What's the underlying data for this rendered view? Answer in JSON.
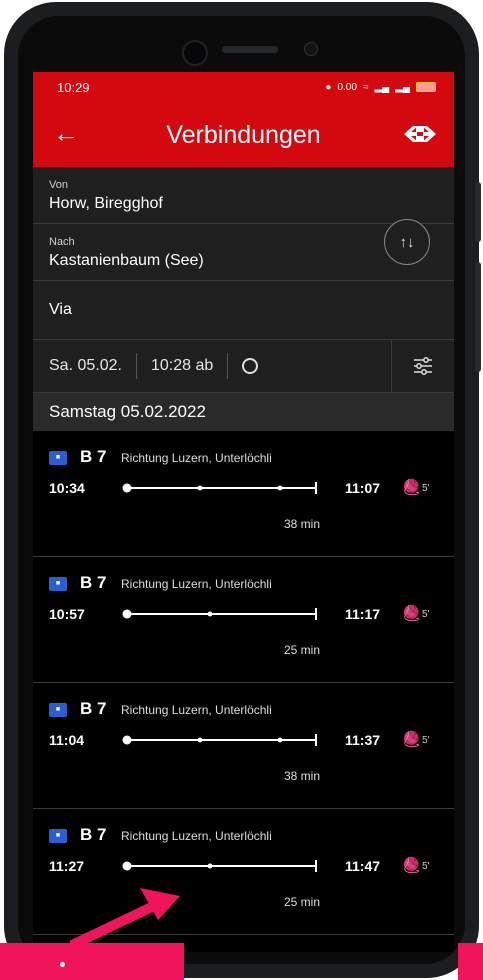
{
  "status": {
    "time": "10:29",
    "speed": "0.00"
  },
  "header": {
    "title": "Verbindungen"
  },
  "form": {
    "from_label": "Von",
    "from_value": "Horw, Biregghof",
    "to_label": "Nach",
    "to_value": "Kastanienbaum (See)",
    "via_label": "Via"
  },
  "datebar": {
    "date": "Sa. 05.02.",
    "time": "10:28 ab"
  },
  "day_header": "Samstag 05.02.2022",
  "connections": [
    {
      "line": "B 7",
      "direction": "Richtung Luzern, Unterlöchli",
      "dep": "10:34",
      "arr": "11:07",
      "walk": "5'",
      "duration": "38 min"
    },
    {
      "line": "B 7",
      "direction": "Richtung Luzern, Unterlöchli",
      "dep": "10:57",
      "arr": "11:17",
      "walk": "5'",
      "duration": "25 min"
    },
    {
      "line": "B 7",
      "direction": "Richtung Luzern, Unterlöchli",
      "dep": "11:04",
      "arr": "11:37",
      "walk": "5'",
      "duration": "38 min"
    },
    {
      "line": "B 7",
      "direction": "Richtung Luzern, Unterlöchli",
      "dep": "11:27",
      "arr": "11:47",
      "walk": "5'",
      "duration": "25 min"
    }
  ],
  "colors": {
    "brand_red": "#d3090f",
    "bus_blue": "#2b5fd0",
    "annotation_pink": "#f0145d"
  },
  "icons": {
    "back": "arrow-left-icon",
    "logo": "sbb-logo-icon",
    "swap": "swap-vertical-icon",
    "clock": "history-icon",
    "filter": "filter-sliders-icon",
    "bus": "bus-icon",
    "walk": "pedestrian-icon"
  }
}
